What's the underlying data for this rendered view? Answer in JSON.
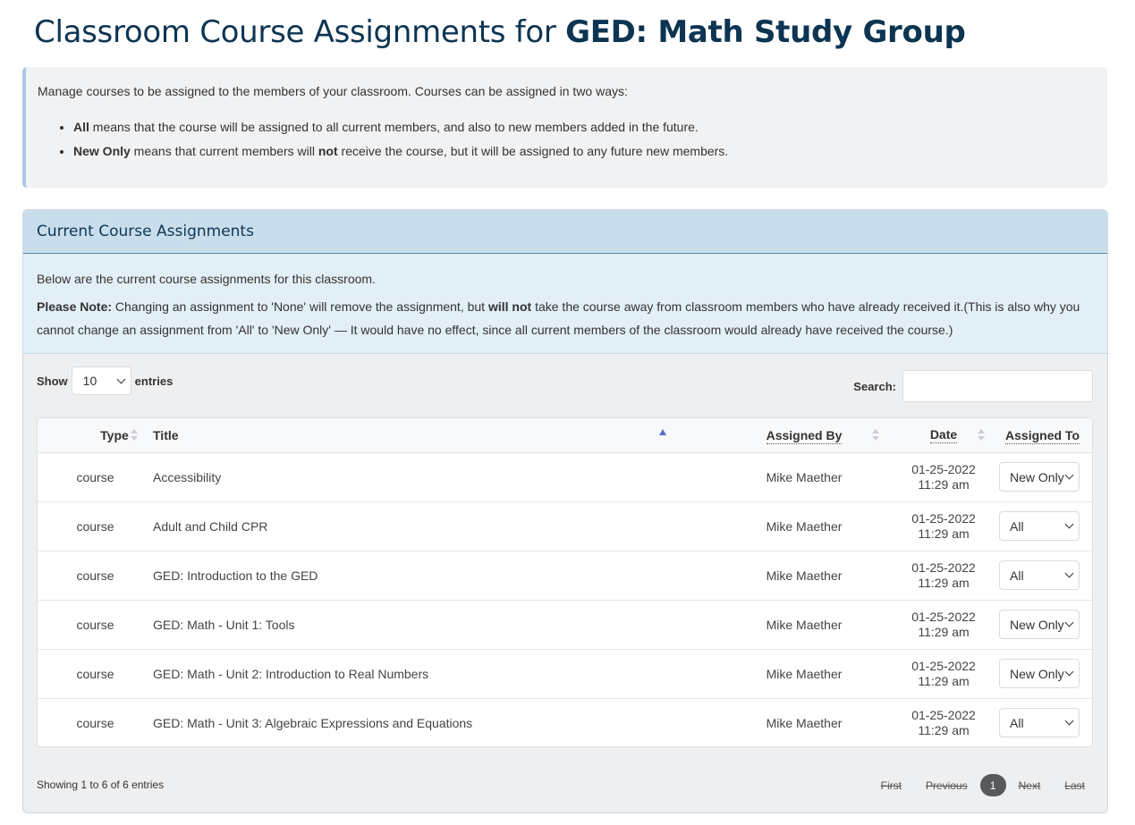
{
  "header": {
    "title_prefix": "Classroom Course Assignments for ",
    "title_group": "GED: Math Study Group"
  },
  "info": {
    "intro": "Manage courses to be assigned to the members of your classroom. Courses can be assigned in two ways:",
    "item1_bold": "All",
    "item1_rest": " means that the course will be assigned to all current members, and also to new members added in the future.",
    "item2_bold": "New Only",
    "item2_mid": " means that current members will ",
    "item2_bold2": "not",
    "item2_rest": " receive the course, but it will be assigned to any future new members."
  },
  "panel": {
    "title": "Current Course Assignments",
    "desc1": "Below are the current course assignments for this classroom.",
    "note_label": "Please Note:",
    "note_a": " Changing an assignment to 'None' will remove the assignment, but ",
    "note_bold": "will not",
    "note_b": " take the course away from classroom members who have already received it.(This is also why you cannot change an assignment from 'All' to 'New Only' — It would have no effect, since all current members of the classroom would already have received the course.)"
  },
  "controls": {
    "show_label": "Show",
    "entries_value": "10",
    "entries_label": "entries",
    "search_label": "Search:",
    "search_value": ""
  },
  "table": {
    "columns": [
      "Type",
      "Title",
      "Assigned By",
      "Date",
      "Assigned To"
    ],
    "rows": [
      {
        "type": "course",
        "title": "Accessibility",
        "by": "Mike Maether",
        "date": "01-25-2022",
        "time": "11:29 am",
        "to": "New Only"
      },
      {
        "type": "course",
        "title": "Adult and Child CPR",
        "by": "Mike Maether",
        "date": "01-25-2022",
        "time": "11:29 am",
        "to": "All"
      },
      {
        "type": "course",
        "title": "GED: Introduction to the GED",
        "by": "Mike Maether",
        "date": "01-25-2022",
        "time": "11:29 am",
        "to": "All"
      },
      {
        "type": "course",
        "title": "GED: Math - Unit 1: Tools",
        "by": "Mike Maether",
        "date": "01-25-2022",
        "time": "11:29 am",
        "to": "New Only"
      },
      {
        "type": "course",
        "title": "GED: Math - Unit 2: Introduction to Real Numbers",
        "by": "Mike Maether",
        "date": "01-25-2022",
        "time": "11:29 am",
        "to": "New Only"
      },
      {
        "type": "course",
        "title": "GED: Math - Unit 3: Algebraic Expressions and Equations",
        "by": "Mike Maether",
        "date": "01-25-2022",
        "time": "11:29 am",
        "to": "All"
      }
    ]
  },
  "footer": {
    "info": "Showing 1 to 6 of 6 entries",
    "first": "First",
    "previous": "Previous",
    "current": "1",
    "next": "Next",
    "last": "Last"
  },
  "colors": {
    "title": "#0d3552",
    "panel_header_bg": "#c9deec",
    "active_page_bg": "#555a5e",
    "sort_active": "#5a6fd0"
  }
}
